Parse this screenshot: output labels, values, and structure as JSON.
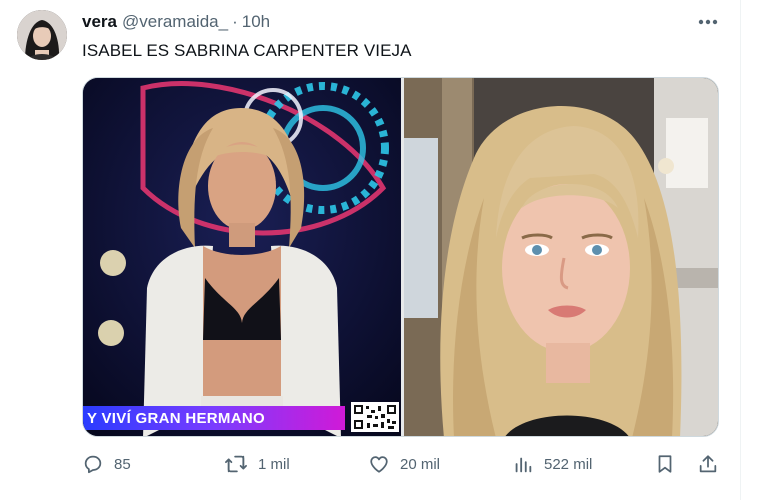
{
  "tweet": {
    "author_name": "vera",
    "author_handle": "@veramaida_",
    "separator": "·",
    "time": "10h",
    "text": "ISABEL ES SABRINA CARPENTER VIEJA",
    "media": {
      "left_banner_text": "Y VIVÍ GRAN HERMANO"
    }
  },
  "actions": {
    "replies": "85",
    "retweets": "1 mil",
    "likes": "20 mil",
    "views": "522 mil"
  },
  "icons": {
    "more": "more-horizontal-icon",
    "reply": "reply-icon",
    "retweet": "retweet-icon",
    "like": "heart-icon",
    "views": "views-chart-icon",
    "bookmark": "bookmark-icon",
    "share": "share-icon"
  },
  "colors": {
    "text_primary": "#0f1419",
    "text_secondary": "#536471",
    "banner_start": "#2a3cff",
    "banner_end": "#d01ad7"
  }
}
